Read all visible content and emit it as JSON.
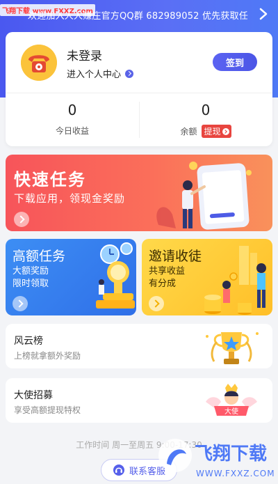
{
  "notice": {
    "site_mark": "飞翔下载 www.FXXZ.com",
    "text": "欢迎加入人人赚庄官方QQ群 682989052 优先获取任"
  },
  "user": {
    "name": "未登录",
    "center_link": "进入个人中心",
    "checkin_label": "签到",
    "today_income_value": "0",
    "today_income_label": "今日收益",
    "balance_value": "0",
    "balance_label": "余额",
    "withdraw_label": "提现"
  },
  "banners": {
    "fast_task": {
      "title": "快速任务",
      "subtitle": "下载应用，领现金奖励"
    },
    "high_task": {
      "title": "高额任务",
      "line1": "大额奖励",
      "line2": "限时领取"
    },
    "invite": {
      "title": "邀请收徒",
      "line1": "共享收益",
      "line2": "有分成"
    }
  },
  "lists": [
    {
      "title": "风云榜",
      "subtitle": "上榜就拿额外奖励"
    },
    {
      "title": "大使招募",
      "subtitle": "享受高额提现特权",
      "badge": "大使"
    }
  ],
  "footer": {
    "work_time": "工作时间 周一至周五 9:00-17:30",
    "contact_label": "联系客服"
  },
  "watermark": {
    "brand": "飞翔下载",
    "url": "WWW.FXXZ.COM"
  },
  "colors": {
    "primary": "#4a58f0",
    "red": "#f7545a",
    "blue_tile": "#3d8ef4",
    "yellow_tile": "#ffc92e"
  }
}
